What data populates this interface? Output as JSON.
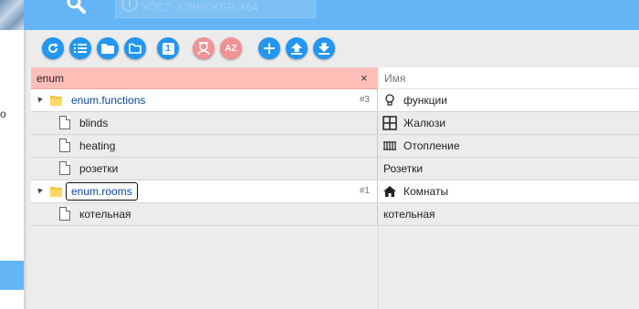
{
  "header": {
    "host_label": "ХОСТ: IOBROKER-X64"
  },
  "left": {
    "glyph": "о"
  },
  "toolbar": {
    "buttons": [
      "refresh-icon",
      "list-view-icon",
      "folder-icon",
      "folder-outline-icon",
      "number-one-icon",
      "expert-mode-icon",
      "sort-az-icon",
      "add-icon",
      "upload-icon",
      "download-icon"
    ],
    "sort_label": "AZ",
    "one_label": "1"
  },
  "table": {
    "filter_id": "enum",
    "filter_name_placeholder": "Имя",
    "clear_symbol": "×",
    "rows": [
      {
        "id": "enum.functions",
        "count": "#3",
        "name": "функции"
      },
      {
        "id": "blinds",
        "name": "Жалюзи"
      },
      {
        "id": "heating",
        "name": "Отопление"
      },
      {
        "id": "розетки",
        "name": "Розетки"
      },
      {
        "id": "enum.rooms",
        "count": "#1",
        "name": "Комнаты"
      },
      {
        "id": "котельная",
        "name": "котельная"
      }
    ]
  },
  "colors": {
    "accent": "#64b5f6",
    "button": "#2196f3",
    "button_disabled": "#f19393",
    "filter_bg": "#ffbfb8"
  }
}
